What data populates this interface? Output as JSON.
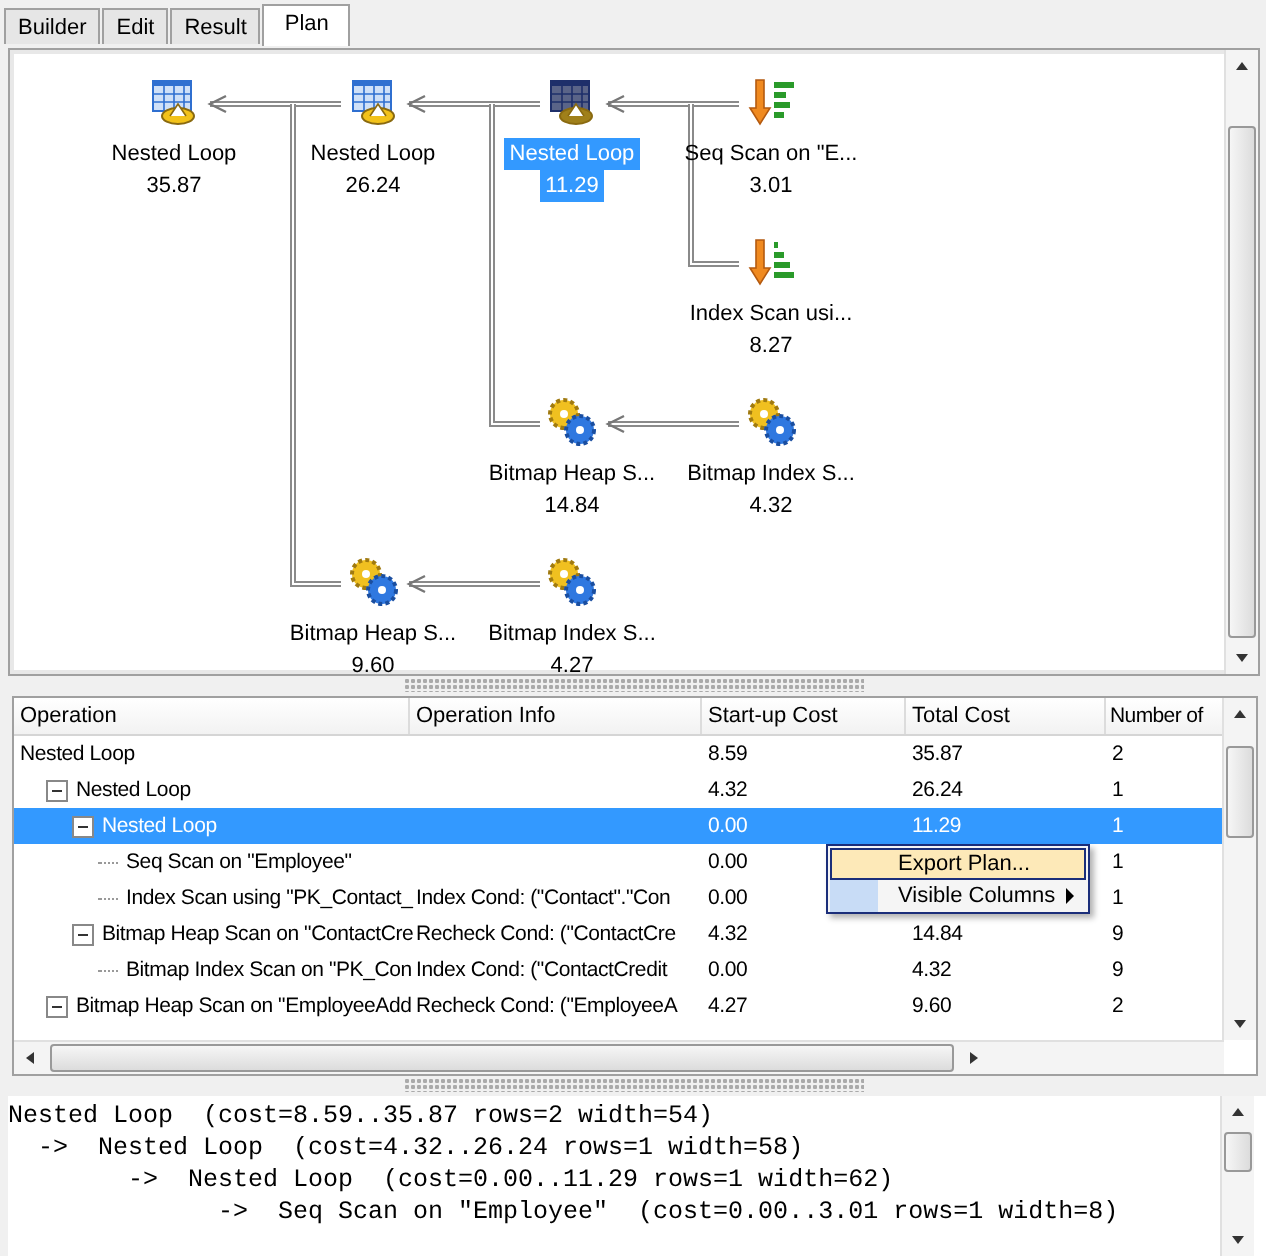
{
  "tabs": [
    {
      "label": "Builder",
      "selected": false
    },
    {
      "label": "Edit",
      "selected": false
    },
    {
      "label": "Result",
      "selected": false
    },
    {
      "label": "Plan",
      "selected": true
    }
  ],
  "plan_tree": {
    "kind": "nested-loop",
    "label": "Nested Loop",
    "value": "35.87",
    "selected": false,
    "children": [
      {
        "kind": "nested-loop",
        "label": "Nested Loop",
        "value": "26.24",
        "selected": false,
        "children": [
          {
            "kind": "nested-loop",
            "label": "Nested Loop",
            "value": "11.29",
            "selected": true,
            "children": [
              {
                "kind": "seq-scan",
                "label": "Seq Scan on \"E...",
                "value": "3.01",
                "selected": false
              },
              {
                "kind": "index-scan",
                "label": "Index Scan usi...",
                "value": "8.27",
                "selected": false
              }
            ]
          },
          {
            "kind": "bitmap",
            "label": "Bitmap Heap S...",
            "value": "14.84",
            "selected": false,
            "children": [
              {
                "kind": "bitmap",
                "label": "Bitmap Index S...",
                "value": "4.32",
                "selected": false
              }
            ]
          }
        ]
      },
      {
        "kind": "bitmap",
        "label": "Bitmap Heap S...",
        "value": "9.60",
        "selected": false,
        "children": [
          {
            "kind": "bitmap",
            "label": "Bitmap Index S...",
            "value": "4.27",
            "selected": false
          }
        ]
      }
    ]
  },
  "grid": {
    "columns": [
      "Operation",
      "Operation Info",
      "Start-up Cost",
      "Total Cost",
      "Number of"
    ],
    "rows": [
      {
        "operation": "Nested Loop",
        "startup": "8.59",
        "total": "35.87",
        "number": "2",
        "selected": false,
        "children": [
          {
            "operation": "Nested Loop",
            "startup": "4.32",
            "total": "26.24",
            "number": "1",
            "selected": false,
            "expanded": true,
            "children": [
              {
                "operation": "Nested Loop",
                "startup": "0.00",
                "total": "11.29",
                "number": "1",
                "selected": true,
                "expanded": true,
                "children": [
                  {
                    "operation": "Seq Scan on \"Employee\"",
                    "startup": "0.00",
                    "number": "1",
                    "selected": false
                  },
                  {
                    "operation": "Index Scan using \"PK_Contact_",
                    "info": "Index Cond: (\"Contact\".\"Con",
                    "startup": "0.00",
                    "number": "1",
                    "selected": false
                  }
                ]
              },
              {
                "operation": "Bitmap Heap Scan on \"ContactCre",
                "info": "Recheck Cond: (\"ContactCre",
                "startup": "4.32",
                "total": "14.84",
                "number": "9",
                "selected": false,
                "expanded": true,
                "children": [
                  {
                    "operation": "Bitmap Index Scan on \"PK_Con",
                    "info": "Index Cond: (\"ContactCredit",
                    "startup": "0.00",
                    "total": "4.32",
                    "number": "9",
                    "selected": false
                  }
                ]
              }
            ]
          },
          {
            "operation": "Bitmap Heap Scan on \"EmployeeAdd",
            "info": "Recheck Cond: (\"EmployeeA",
            "startup": "4.27",
            "total": "9.60",
            "number": "2",
            "selected": false,
            "expanded": true
          }
        ]
      }
    ]
  },
  "context_menu": {
    "items": [
      {
        "label": "Export Plan...",
        "selected": true
      },
      {
        "label": "Visible Columns",
        "selected": false,
        "submenu": true
      }
    ]
  },
  "plan_text": [
    "Nested Loop  (cost=8.59..35.87 rows=2 width=54)",
    "  ->  Nested Loop  (cost=4.32..26.24 rows=1 width=58)",
    "        ->  Nested Loop  (cost=0.00..11.29 rows=1 width=62)",
    "              ->  Seq Scan on \"Employee\"  (cost=0.00..3.01 rows=1 width=8)"
  ]
}
